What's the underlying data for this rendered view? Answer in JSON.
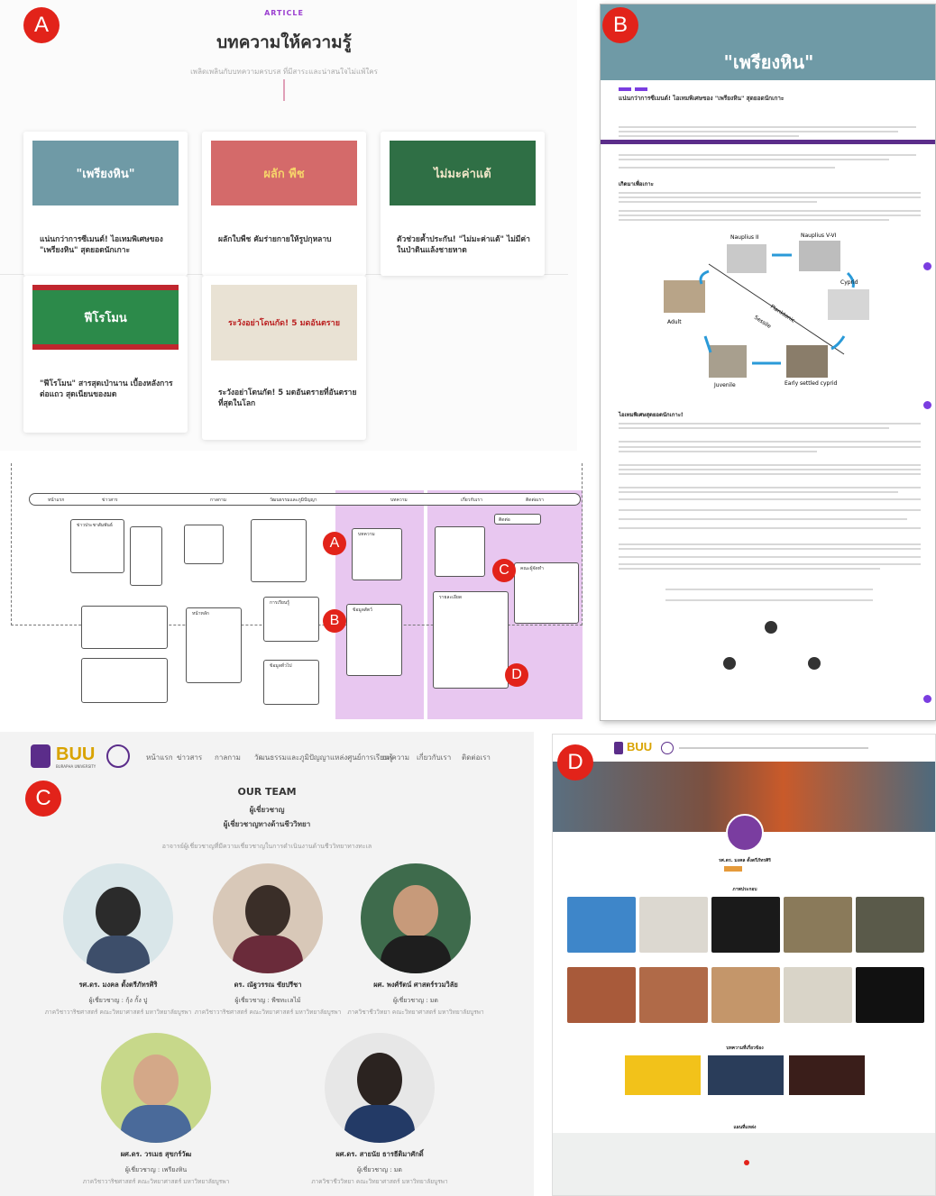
{
  "markers": {
    "a": "A",
    "b": "B",
    "c": "C",
    "d": "D"
  },
  "diagram_markers": {
    "a": "A",
    "b": "B",
    "c": "C",
    "d": "D"
  },
  "panelA": {
    "kicker": "ARTICLE",
    "title": "บทความให้ความรู้",
    "subtitle": "เพลิดเพลินกับบทความครบรส ที่มีสาระและน่าสนใจไม่แพ้ใคร",
    "cards": [
      {
        "img_text": "\"เพรียงหิน\"",
        "caption": "แน่นกว่าการซีเมนต์! ไอเทมพิเศษของ \"เพรียงหิน\" สุดยอดนักเกาะ",
        "color": "#6f9aa6"
      },
      {
        "img_text": "ผลัก พืช",
        "caption": "ผลักใบพืช คัมร่ายกายให้รูปกุหลาบ",
        "color": "#d46a6a"
      },
      {
        "img_text": "ไม่มะค่าแต้",
        "caption": "ตัวช่วยค้ำประกัน! \"ไม่มะค่าแต้\" ไม่มีค่าในป่าดินแล้งชายหาด",
        "color": "#2f6f45"
      },
      {
        "img_text": "ฟีโรโมน",
        "caption": "\"ฟีโรโมน\" สารสุดเป่านาน เบื้องหลังการต่อแถว สุดเนียนของมด",
        "color": "#2c8a4a"
      },
      {
        "img_text": "ระวังอย่าโดนกัด! 5 มดอันตราย",
        "caption": "ระวังอย่าโดนกัด! 5 มดอันตรายที่อันตรายที่สุดในโลก",
        "color": "#e9e2d4"
      }
    ]
  },
  "diagram": {
    "nav": [
      "หน้าแรก",
      "ข่าวสาร",
      "กาลกาม",
      "วัฒนธรรมและภูมิปัญญา",
      "บทความ",
      "เกี่ยวกับเรา",
      "ติดต่อเรา"
    ],
    "boxes": [
      "ข่าวประชาสัมพันธ์",
      "หน้าหลัก",
      "การเรียนรู้",
      "บทความ",
      "ข้อมูลทั่วไป",
      "คณะผู้จัดทำ",
      "ข้อมูลสัตว์",
      "รายละเอียด",
      "ติดต่อ"
    ]
  },
  "panelB": {
    "banner": "\"เพรียงหิน\"",
    "heading": "แน่นกว่าการซีเมนต์! ไอเทมพิเศษของ \"เพรียงหิน\" สุดยอดนักเกาะ",
    "section1": "เกิดมาเพื่อเกาะ",
    "section2": "ไอเทมพิเศษสุดยอดนักเกาะ!",
    "lifecycle": [
      "Nauplius II",
      "Nauplius V-VI",
      "Cyprid",
      "Planktonic",
      "Sessile",
      "Adult",
      "Juvenile",
      "Early settled cyprid"
    ]
  },
  "panelC": {
    "nav": [
      "หน้าแรก",
      "ข่าวสาร",
      "กาลกาม",
      "วัฒนธรรมและภูมิปัญญา",
      "แหล่งศูนย์การเรียนรู้",
      "บทความ",
      "เกี่ยวกับเรา",
      "ติดต่อเรา"
    ],
    "logo": "BUU",
    "logo_sub": "BURAPHA UNIVERSITY",
    "team_title": "OUR TEAM",
    "team_sub1": "ผู้เชี่ยวชาญ",
    "team_sub2": "ผู้เชี่ยวชาญทางด้านชีววิทยา",
    "intro": "อาจารย์ผู้เชี่ยวชาญที่มีความเชี่ยวชาญในการดำเนินงานด้านชีววิทยาทางทะเล",
    "members": [
      {
        "name": "รศ.ดร. มงคล ตั้งตรีภัทรศิริ",
        "role": "ผู้เชี่ยวชาญ : กุ้ง กั้ง ปู",
        "dept": "ภาควิชาวาริชศาสตร์ คณะวิทยาศาสตร์ มหาวิทยาลัยบูรพา"
      },
      {
        "name": "ดร. ณัฐวรรณ ชัยปรีชา",
        "role": "ผู้เชี่ยวชาญ : พืชทะเลไม้",
        "dept": "ภาควิชาวาริชศาสตร์ คณะวิทยาศาสตร์ มหาวิทยาลัยบูรพา"
      },
      {
        "name": "ผศ. พงศ์รัตน์ ศาสตร์รวมวิลัย",
        "role": "ผู้เชี่ยวชาญ : มด",
        "dept": "ภาควิชาชีววิทยา คณะวิทยาศาสตร์ มหาวิทยาลัยบูรพา"
      },
      {
        "name": "ผศ.ดร. วรเมธ สุขกร์วัฒ",
        "role": "ผู้เชี่ยวชาญ : เพรียงหิน",
        "dept": "ภาควิชาวาริชศาสตร์ คณะวิทยาศาสตร์ มหาวิทยาลัยบูรพา"
      },
      {
        "name": "ผศ.ดร. สายนัย ธารธีติมาศักดิ์",
        "role": "ผู้เชี่ยวชาญ : มด",
        "dept": "ภาควิชาชีววิทยา คณะวิทยาศาสตร์ มหาวิทยาลัยบูรพา"
      }
    ]
  },
  "panelD": {
    "logo": "BUU",
    "profile_name": "รศ.ดร. มงคล ตั้งตรีภัทรศิริ",
    "gallery_title": "ภาพประกอบ",
    "related_title": "บทความที่เกี่ยวข้อง",
    "map_title": "แผนที่แหล่ง"
  },
  "colors": {
    "accent": "#9b3fd0",
    "marker": "#e2231a",
    "purple_highlight": "#e8c7f0",
    "banner": "#6f9aa6"
  }
}
